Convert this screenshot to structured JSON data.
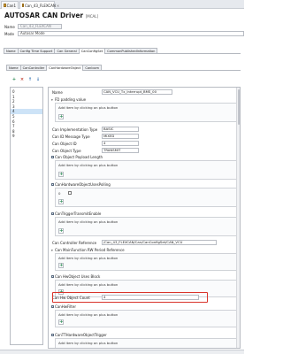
{
  "doc_tabs": [
    {
      "label": "Can1",
      "active": false
    },
    {
      "label": "Can_43_FLEXCAN",
      "active": true
    }
  ],
  "header": {
    "title": "AUTOSAR CAN Driver",
    "tag": "[MCAL]"
  },
  "name_field": {
    "label": "Name",
    "value": "Can_43_FLEXCAN"
  },
  "mode_field": {
    "label": "Mode",
    "value": "Autosar Mode"
  },
  "top_tabs": [
    "Name",
    "Config Time Support",
    "Can General",
    "CanConfigSet",
    "CommonPublishedInformation"
  ],
  "sub_tabs": [
    "Name",
    "CanController",
    "CanHardwareObject",
    "Canlcom"
  ],
  "list_items": [
    "0",
    "1",
    "2",
    "3",
    "4",
    "5",
    "6",
    "7",
    "8",
    "9"
  ],
  "selected_index": 4,
  "props": {
    "name_label": "Name",
    "name_value": "CAN_VCU_Tx_Interrupt_BMS_00",
    "padding_label": "FD padding value",
    "add_hint": "Add item by clicking on plus button",
    "impl_type_label": "Can Implementation Type",
    "impl_type_value": "BASIC",
    "id_msg_type_label": "Can ID Message Type",
    "id_msg_type_value": "MIXED",
    "obj_id_label": "Can Object ID",
    "obj_id_value": "4",
    "obj_type_label": "Can Object Type",
    "obj_type_value": "TRANSMIT",
    "payload_label": "Can Object Payload Length",
    "polling_label": "CanHardwareObjectUsesPolling",
    "polling_value": "0",
    "trigger_label": "CanTriggerTransmitEnable",
    "controller_ref_label": "Can Controller Reference",
    "controller_ref_value": "/Can_43_FLEXCAN/Can/CanConfigSet/CAN_VCU",
    "mainfunc_label": "Can MainFunction RW Period Reference",
    "uses_block_label": "Can HwObject Uses Block",
    "hw_count_label": "Can Hw Object Count",
    "hw_count_value": "4",
    "hwfilter_label": "CanHwFilter",
    "ttrigger_label": "CanTTHardwareObjectTrigger"
  }
}
